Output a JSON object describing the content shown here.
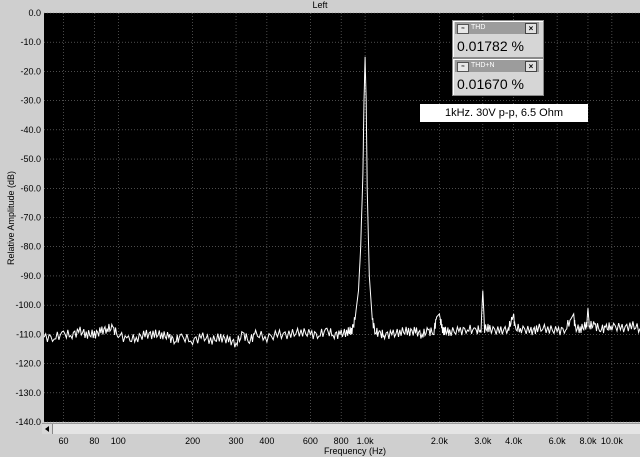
{
  "window": {
    "title": "Left"
  },
  "readouts": {
    "thd": {
      "label": "THD",
      "value": "0.01782 %"
    },
    "thdn": {
      "label": "THD+N",
      "value": "0.01670 %"
    }
  },
  "annotation": "1kHz. 30V p-p, 6.5 Ohm",
  "icons": {
    "readout_icon": "meter-icon",
    "close": "close-icon",
    "scroll_left": "arrow-left-icon"
  },
  "colors": {
    "plot_background": "#000000",
    "trace": "#ffffff",
    "grid": "#7a7a7a",
    "chrome": "#cfcfcf"
  },
  "chart_data": {
    "type": "line",
    "title": "Left",
    "xlabel": "Frequency (Hz)",
    "ylabel": "Relative Amplitude (dB)",
    "x_scale": "log",
    "xlim": [
      50,
      13000
    ],
    "ylim": [
      -140,
      0
    ],
    "grid": true,
    "y_ticks": [
      "0.0",
      "-10.0",
      "-20.0",
      "-30.0",
      "-40.0",
      "-50.0",
      "-60.0",
      "-70.0",
      "-80.0",
      "-90.0",
      "-100.0",
      "-110.0",
      "-120.0",
      "-130.0",
      "-140.0"
    ],
    "y_tick_values": [
      0,
      -10,
      -20,
      -30,
      -40,
      -50,
      -60,
      -70,
      -80,
      -90,
      -100,
      -110,
      -120,
      -130,
      -140
    ],
    "x_ticks": [
      "60",
      "80",
      "100",
      "200",
      "300",
      "400",
      "600",
      "800",
      "1.0k",
      "2.0k",
      "3.0k",
      "4.0k",
      "6.0k",
      "8.0k",
      "10.0k"
    ],
    "x_tick_values": [
      60,
      80,
      100,
      200,
      300,
      400,
      600,
      800,
      1000,
      2000,
      3000,
      4000,
      6000,
      8000,
      10000
    ],
    "series": [
      {
        "x": [
          50,
          55,
          60,
          65,
          70,
          75,
          80,
          85,
          90,
          95,
          100,
          110,
          120,
          130,
          140,
          150,
          160,
          170,
          180,
          200,
          220,
          240,
          260,
          280,
          300,
          320,
          340,
          360,
          400,
          450,
          500,
          550,
          600,
          650,
          700,
          750,
          800,
          850,
          880,
          910,
          940,
          960,
          980,
          990,
          1000,
          1010,
          1020,
          1040,
          1070,
          1100,
          1150,
          1200,
          1300,
          1400,
          1500,
          1600,
          1700,
          1800,
          1900,
          1950,
          2000,
          2050,
          2100,
          2200,
          2400,
          2600,
          2800,
          2950,
          3000,
          3050,
          3200,
          3500,
          3800,
          3950,
          4000,
          4050,
          4300,
          4700,
          5000,
          5500,
          6000,
          6500,
          6900,
          7000,
          7100,
          7500,
          7900,
          8000,
          8100,
          8500,
          9000,
          9500,
          10000,
          11000,
          12000,
          13000
        ],
        "y": [
          -111,
          -111,
          -110,
          -110,
          -109,
          -110,
          -110,
          -109,
          -108,
          -108,
          -110,
          -112,
          -111,
          -110,
          -110,
          -110,
          -111,
          -112,
          -111,
          -112,
          -111,
          -112,
          -111,
          -112,
          -113,
          -110,
          -112,
          -110,
          -111,
          -110,
          -110,
          -109,
          -110,
          -110,
          -109,
          -110,
          -110,
          -109,
          -109,
          -105,
          -95,
          -80,
          -55,
          -30,
          -15,
          -30,
          -60,
          -90,
          -105,
          -109,
          -110,
          -110,
          -110,
          -109,
          -109,
          -109,
          -110,
          -109,
          -109,
          -104,
          -103,
          -108,
          -109,
          -109,
          -109,
          -108,
          -109,
          -108,
          -95,
          -108,
          -108,
          -109,
          -108,
          -105,
          -103,
          -108,
          -108,
          -109,
          -108,
          -108,
          -109,
          -108,
          -104,
          -103,
          -108,
          -108,
          -107,
          -101,
          -107,
          -107,
          -108,
          -108,
          -107,
          -108,
          -107,
          -108
        ]
      }
    ]
  }
}
